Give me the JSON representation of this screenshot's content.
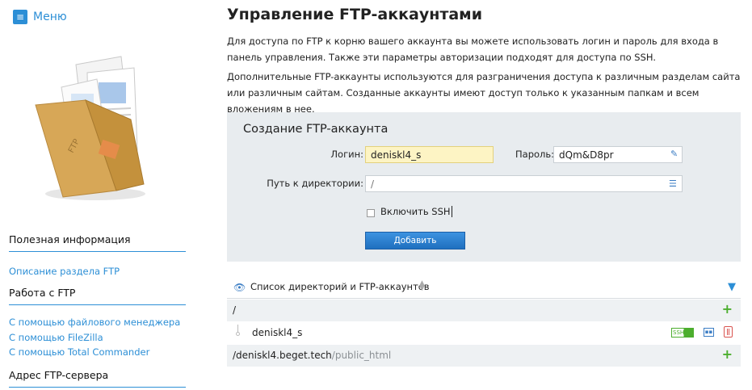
{
  "sidebar": {
    "menu_label": "Меню",
    "menu_icon": "hamburger-icon",
    "sections": [
      {
        "heading": "Полезная информация",
        "links": [
          "Описание раздела FTP"
        ]
      },
      {
        "heading": "Работа с FTP",
        "links": [
          "С помощью файлового менеджера",
          "С помощью FileZilla",
          "С помощью Total Commander"
        ]
      },
      {
        "heading": "Адрес FTP-сервера",
        "links": []
      }
    ]
  },
  "main": {
    "title": "Управление FTP-аккаунтами",
    "paragraphs": [
      "Для доступа по FTP к корню вашего аккаунта вы можете использовать логин и пароль для входа в панель управления. Также эти параметры авторизации подходят для доступа по SSH.",
      "Дополнительные FTP-аккаунты используются для разграничения доступа к различным разделам сайта или различным сайтам. Созданные аккаунты имеют доступ только к указанным папкам и всем вложениям в нее."
    ],
    "create": {
      "title": "Создание FTP-аккаунта",
      "login_label": "Логин:",
      "login_value": "deniskl4_s",
      "password_label": "Пароль:",
      "password_value": "dQm&D8pr",
      "path_label": "Путь к директории:",
      "path_value": "/",
      "ssh_label": "Включить SSH",
      "ssh_checked": false,
      "add_button": "Добавить"
    },
    "list": {
      "title": "Список директорий и FTP-аккаунтов",
      "rows": [
        {
          "type": "directory",
          "path": "/"
        },
        {
          "type": "account",
          "name": "deniskl4_s",
          "badge": "SSH"
        },
        {
          "type": "directory",
          "path_main": "/deniskl4.beget.tech",
          "path_muted": "/public_html"
        }
      ]
    }
  },
  "colors": {
    "accent": "#2d8fd6",
    "panel_bg": "#e8ecef",
    "login_bg": "#fdf4c4",
    "add_green": "#4cae2e",
    "delete_red": "#d9534f"
  }
}
